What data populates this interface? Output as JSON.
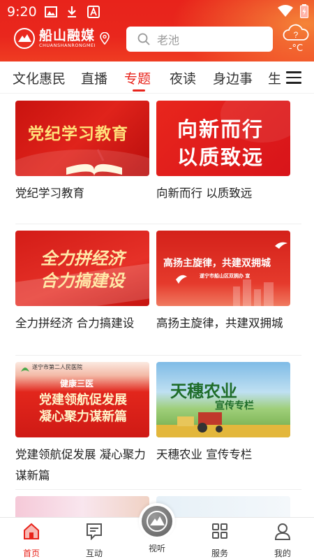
{
  "status_bar": {
    "time": "9:20"
  },
  "header": {
    "logo_cn": "船山融媒",
    "logo_en": "CHUANSHANRONGMEI",
    "search_placeholder": "老池",
    "weather_temp": "-°C",
    "weather_icon": "question-cloud-icon"
  },
  "tabs": [
    {
      "label": "文化惠民"
    },
    {
      "label": "直播"
    },
    {
      "label": "专题",
      "active": true
    },
    {
      "label": "夜读"
    },
    {
      "label": "身边事"
    },
    {
      "label": "生"
    }
  ],
  "cards": [
    {
      "caption": "党纪学习教育",
      "thumb_title": "党纪学习教育"
    },
    {
      "caption": "向新而行 以质致远",
      "thumb_line1": "向新而行",
      "thumb_line2": "以质致远"
    },
    {
      "caption": "全力拼经济 合力搞建设",
      "thumb_line1": "全力拼经济",
      "thumb_line2": "合力搞建设"
    },
    {
      "caption": "高扬主旋律，共建双拥城",
      "thumb_title": "高扬主旋律，共建双拥城",
      "thumb_sub": "遂宁市船山区双拥办 宣"
    },
    {
      "caption": "党建领航促发展 凝心聚力谋新篇",
      "thumb_top": "遂宁市第二人民医院",
      "thumb_line0": "健康三医",
      "thumb_line1": "党建领航促发展",
      "thumb_line2": "凝心聚力谋新篇"
    },
    {
      "caption": "天穗农业 宣传专栏",
      "thumb_line1": "天穗农业",
      "thumb_line2": "宣传专栏"
    }
  ],
  "bottom_nav": [
    {
      "label": "首页",
      "icon": "home-icon",
      "active": true
    },
    {
      "label": "互动",
      "icon": "chat-icon"
    },
    {
      "label": "视听",
      "icon": "media-logo-icon"
    },
    {
      "label": "服务",
      "icon": "grid-icon"
    },
    {
      "label": "我的",
      "icon": "user-icon"
    }
  ],
  "colors": {
    "brand_red": "#e8231b",
    "caption_text": "#222222"
  }
}
